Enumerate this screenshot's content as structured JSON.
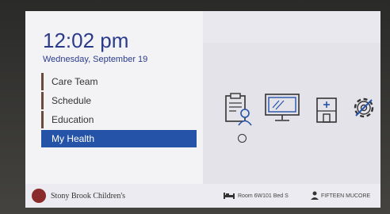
{
  "header": {
    "time": "12:02 pm",
    "date": "Wednesday, September 19"
  },
  "menu": {
    "items": [
      {
        "label": "Care Team"
      },
      {
        "label": "Schedule"
      },
      {
        "label": "Education"
      },
      {
        "label": "My Health",
        "active": true
      }
    ]
  },
  "icons": [
    {
      "name": "care-team-clipboard-icon"
    },
    {
      "name": "monitor-tv-icon"
    },
    {
      "name": "hospital-building-icon"
    },
    {
      "name": "settings-gear-icon"
    }
  ],
  "footer": {
    "brand": "Stony Brook Children's",
    "room": "Room 6W101 Bed S",
    "patient": "FIFTEEN MUCORE"
  },
  "colors": {
    "accent": "#2553a8",
    "brand_red": "#8a2a2a",
    "text_primary": "#2b3b8a"
  }
}
